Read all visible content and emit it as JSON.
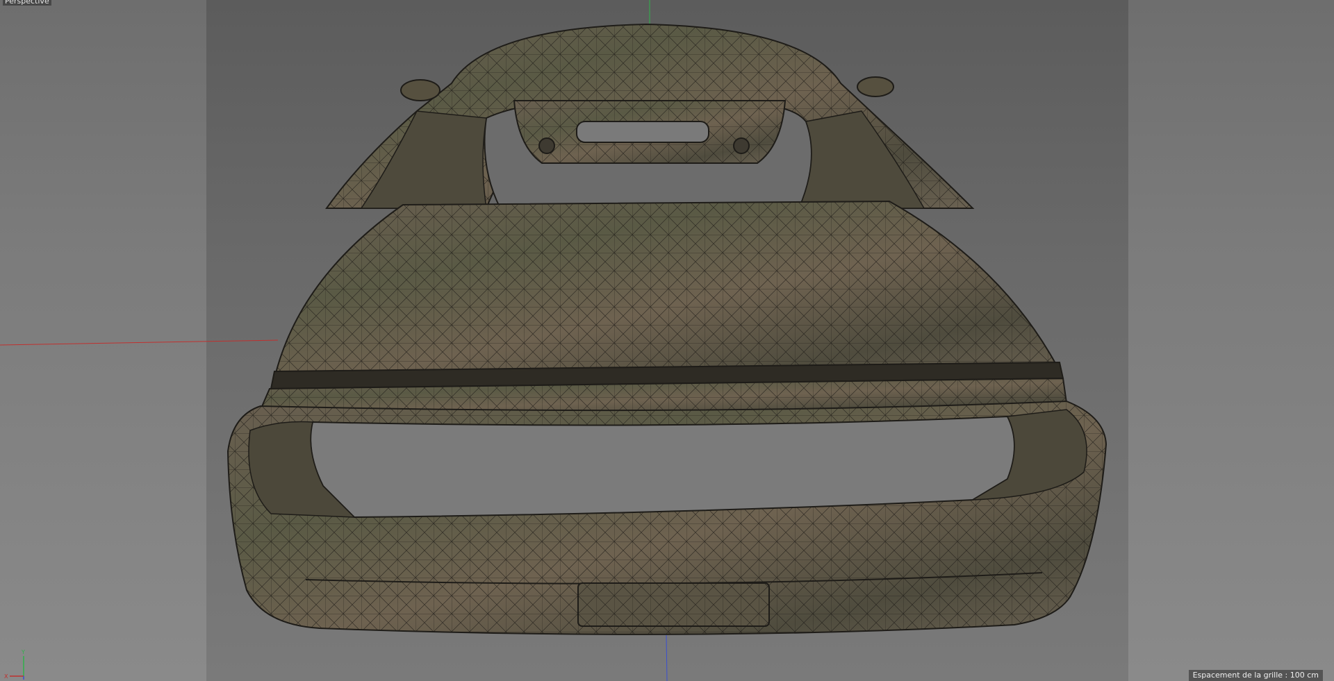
{
  "viewport": {
    "camera_label": "Perspective",
    "grid_spacing_label": "Espacement de la grille : 100 cm"
  },
  "axis_gizmo": {
    "x_label": "X",
    "y_label": "Y"
  },
  "colors": {
    "viewport_bg": "#7b7b7b",
    "x_axis": "#c0302e",
    "y_axis": "#2fb14a",
    "z_axis": "#3a4fd0",
    "mesh_fill": "#5e5647",
    "wireframe": "#1e1c18"
  },
  "scene": {
    "object": "car body (rear view)",
    "display_mode": "textured wireframe"
  }
}
